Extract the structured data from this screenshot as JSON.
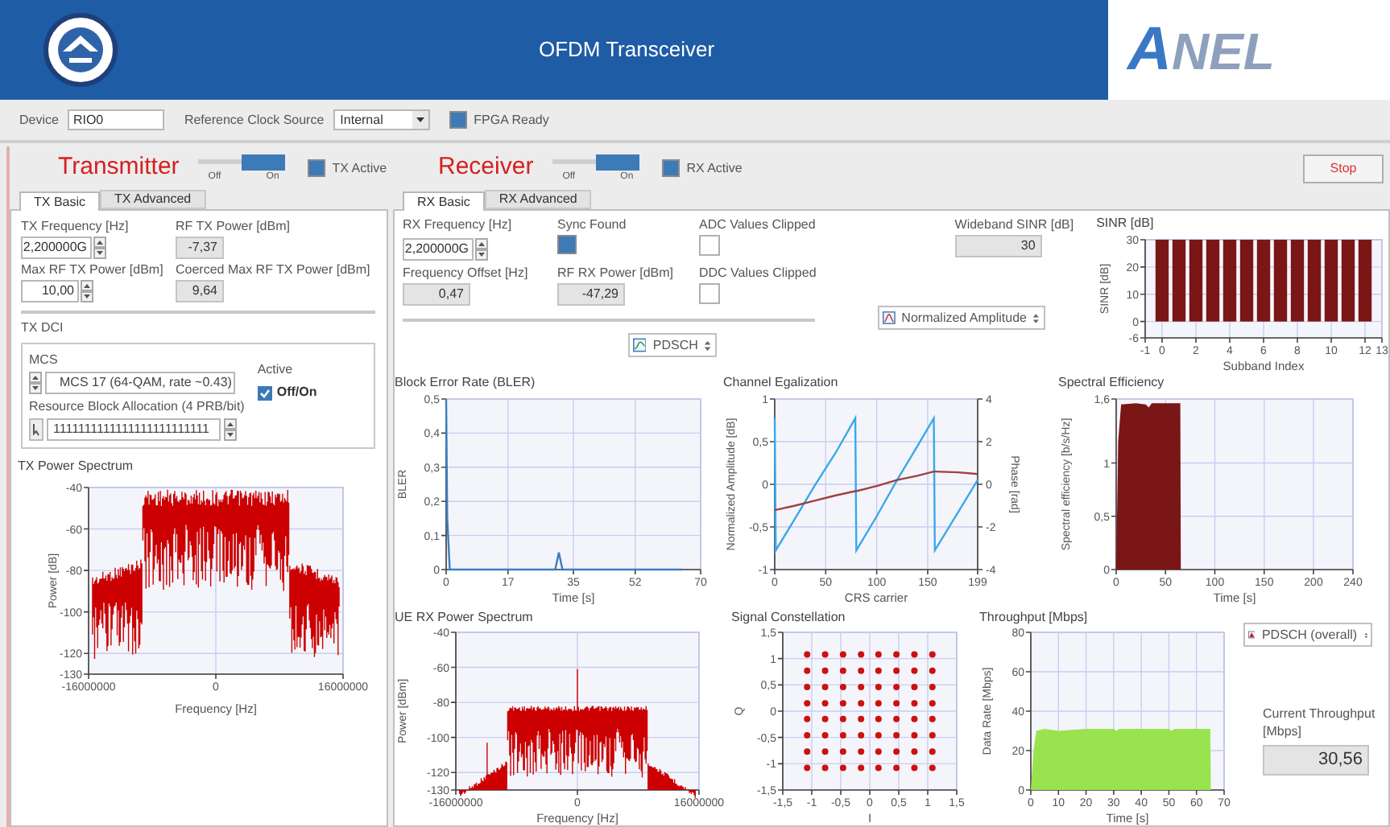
{
  "header": {
    "title": "OFDM Transceiver",
    "brand": "ANEL"
  },
  "toolbar": {
    "device_label": "Device",
    "device_value": "RIO0",
    "clock_label": "Reference Clock Source",
    "clock_value": "Internal",
    "fpga_label": "FPGA Ready",
    "fpga_ready": true
  },
  "transmitter": {
    "title": "Transmitter",
    "switch": {
      "off_label": "Off",
      "on_label": "On",
      "on": true
    },
    "active": {
      "label": "TX Active",
      "on": true
    },
    "tabs": [
      {
        "label": "TX Basic",
        "selected": true
      },
      {
        "label": "TX Advanced",
        "selected": false
      }
    ],
    "tx_frequency": {
      "label": "TX Frequency [Hz]",
      "value": "2,200000G"
    },
    "rf_tx_power": {
      "label": "RF TX Power [dBm]",
      "value": "-7,37"
    },
    "max_rf_tx_power": {
      "label": "Max RF TX Power [dBm]",
      "value": "10,00"
    },
    "coerced_max_power": {
      "label": "Coerced Max RF TX Power [dBm]",
      "value": "9,64"
    },
    "dci": {
      "title": "TX DCI",
      "mcs_label": "MCS",
      "mcs_value": "MCS 17 (64-QAM, rate ~0.43)",
      "active_label": "Active",
      "active_option": {
        "label": "Off/On",
        "checked": true
      },
      "rba_label": "Resource Block Allocation (4 PRB/bit)",
      "rba_value": "1111111111111111111111111"
    },
    "spectrum": {
      "title": "TX Power Spectrum",
      "xlabel": "Frequency [Hz]",
      "ylabel": "Power [dB]",
      "xticks": [
        "-16000000",
        "0",
        "16000000"
      ],
      "yticks": [
        "-40",
        "-60",
        "-80",
        "-100",
        "-120",
        "-130"
      ]
    }
  },
  "receiver": {
    "title": "Receiver",
    "switch": {
      "off_label": "Off",
      "on_label": "On",
      "on": true
    },
    "active": {
      "label": "RX Active",
      "on": true
    },
    "stop_button": "Stop",
    "tabs": [
      {
        "label": "RX Basic",
        "selected": true
      },
      {
        "label": "RX Advanced",
        "selected": false
      }
    ],
    "rx_frequency": {
      "label": "RX Frequency [Hz]",
      "value": "2,200000G"
    },
    "sync_found": {
      "label": "Sync Found",
      "on": true
    },
    "adc_clipped": {
      "label": "ADC Values Clipped",
      "on": false
    },
    "frequency_offset": {
      "label": "Frequency Offset [Hz]",
      "value": "0,47"
    },
    "rf_rx_power": {
      "label": "RF RX Power [dBm]",
      "value": "-47,29"
    },
    "ddc_clipped": {
      "label": "DDC Values Clipped",
      "on": false
    },
    "wideband_sinr": {
      "label": "Wideband SINR [dB]",
      "value": "30"
    },
    "channel_selector": {
      "value": "PDSCH"
    },
    "equalization_selector": {
      "value": "Normalized Amplitude"
    },
    "sinr": {
      "chart_data": {
        "type": "bar",
        "title": "SINR [dB]",
        "xlabel": "Subband Index",
        "ylabel": "SINR [dB]",
        "x": [
          0,
          1,
          2,
          3,
          4,
          5,
          6,
          7,
          8,
          9,
          10,
          11,
          12
        ],
        "series": [
          {
            "color": "#7a1616",
            "values": [
              30,
              30,
              30,
              30,
              30,
              30,
              30,
              30,
              30,
              30,
              30,
              30,
              30
            ]
          }
        ],
        "grid": true,
        "xlim": [
          -1,
          13
        ],
        "ylim": [
          -6,
          30
        ],
        "xticks": [
          -1,
          0,
          2,
          4,
          6,
          8,
          10,
          12,
          13
        ],
        "yticks": [
          -6,
          0,
          10,
          20,
          30
        ]
      }
    },
    "bler": {
      "chart_data": {
        "type": "line",
        "title": "Block Error Rate (BLER)",
        "xlabel": "Time [s]",
        "ylabel": "BLER",
        "x": [
          0,
          0.3,
          1,
          30,
          31,
          32,
          65
        ],
        "series": [
          {
            "color": "#3a7fc1",
            "values": [
              0.5,
              0.15,
              0,
              0,
              0.05,
              0,
              0
            ]
          }
        ],
        "grid": true,
        "xlim": [
          0,
          70
        ],
        "ylim": [
          0,
          0.5
        ],
        "xticks": [
          0,
          17,
          35,
          52,
          70
        ],
        "yticks": [
          {
            "value": 0,
            "label": "0"
          },
          {
            "value": 0.1,
            "label": "0,1"
          },
          {
            "value": 0.2,
            "label": "0,2"
          },
          {
            "value": 0.3,
            "label": "0,3"
          },
          {
            "value": 0.4,
            "label": "0,4"
          },
          {
            "value": 0.5,
            "label": "0,5"
          }
        ]
      }
    },
    "channel_equalization": {
      "chart_data": {
        "type": "line",
        "title": "Channel Egalization",
        "xlabel": "CRS carrier",
        "ylabel": "Normalized Amplitude [dB]",
        "y2label": "Phase [rad]",
        "grid": true,
        "x": [
          0,
          1,
          20,
          40,
          60,
          79,
          80,
          100,
          120,
          140,
          156,
          157,
          180,
          199
        ],
        "series": [
          {
            "color": "#3aa8ea",
            "axis": "y2",
            "values": [
              3.1,
              -3.1,
              -1.6,
              0,
              1.5,
              3.1,
              -3.1,
              -1.5,
              0.2,
              1.8,
              3.1,
              -3.1,
              -1.3,
              0.2
            ]
          },
          {
            "color": "#a04040",
            "values": [
              -0.3,
              -0.3,
              -0.25,
              -0.19,
              -0.13,
              -0.08,
              -0.08,
              -0.02,
              0.05,
              0.1,
              0.15,
              0.15,
              0.14,
              0.12
            ]
          }
        ],
        "xlim": [
          0,
          199
        ],
        "ylim": [
          -1,
          1
        ],
        "y2lim": [
          -4,
          4
        ],
        "xticks": [
          0,
          50,
          100,
          150,
          199
        ],
        "yticks": [
          {
            "value": 1,
            "label": "1"
          },
          {
            "value": 0.5,
            "label": "0,5"
          },
          {
            "value": 0,
            "label": "0"
          },
          {
            "value": -0.5,
            "label": "-0,5"
          },
          {
            "value": -1,
            "label": "-1"
          }
        ],
        "y2ticks": [
          4,
          2,
          0,
          -2,
          -4
        ]
      }
    },
    "spectral_efficiency": {
      "chart_data": {
        "type": "area",
        "title": "Spectral Efficiency",
        "xlabel": "Time [s]",
        "ylabel": "Spectral efficiency [b/s/Hz]",
        "x": [
          0,
          2,
          5,
          20,
          30,
          33,
          36,
          50,
          65,
          65.5
        ],
        "series": [
          {
            "color": "#7a1616",
            "values": [
              0,
              1.2,
              1.55,
              1.56,
              1.55,
              1.52,
              1.56,
              1.56,
              1.56,
              0
            ]
          }
        ],
        "grid": true,
        "xlim": [
          0,
          240
        ],
        "ylim": [
          0,
          1.6
        ],
        "xticks": [
          0,
          50,
          100,
          150,
          200,
          240
        ],
        "yticks": [
          {
            "value": 0,
            "label": "0"
          },
          {
            "value": 0.5,
            "label": "0,5"
          },
          {
            "value": 1,
            "label": "1"
          },
          {
            "value": 1.6,
            "label": "1,6"
          }
        ]
      }
    },
    "rx_spectrum": {
      "title": "UE RX Power Spectrum",
      "xlabel": "Frequency [Hz]",
      "ylabel": "Power [dBm]",
      "xticks": [
        "-16000000",
        "0",
        "16000000"
      ],
      "yticks": [
        "-40",
        "-60",
        "-80",
        "-100",
        "-120",
        "-130"
      ]
    },
    "constellation": {
      "chart_data": {
        "type": "scatter",
        "title": "Signal Constellation",
        "xlabel": "I",
        "ylabel": "Q",
        "x": [
          -1.08,
          -0.77,
          -0.46,
          -0.15,
          0.15,
          0.46,
          0.77,
          1.08,
          -1.08,
          -0.77,
          -0.46,
          -0.15,
          0.15,
          0.46,
          0.77,
          1.08,
          -1.08,
          -0.77,
          -0.46,
          -0.15,
          0.15,
          0.46,
          0.77,
          1.08,
          -1.08,
          -0.77,
          -0.46,
          -0.15,
          0.15,
          0.46,
          0.77,
          1.08,
          -1.08,
          -0.77,
          -0.46,
          -0.15,
          0.15,
          0.46,
          0.77,
          1.08,
          -1.08,
          -0.77,
          -0.46,
          -0.15,
          0.15,
          0.46,
          0.77,
          1.08,
          -1.08,
          -0.77,
          -0.46,
          -0.15,
          0.15,
          0.46,
          0.77,
          1.08,
          -1.08,
          -0.77,
          -0.46,
          -0.15,
          0.15,
          0.46,
          0.77,
          1.08
        ],
        "grid": true,
        "series": [
          {
            "color": "#cc1111",
            "values": [
              1.08,
              1.08,
              1.08,
              1.08,
              1.08,
              1.08,
              1.08,
              1.08,
              0.77,
              0.77,
              0.77,
              0.77,
              0.77,
              0.77,
              0.77,
              0.77,
              0.46,
              0.46,
              0.46,
              0.46,
              0.46,
              0.46,
              0.46,
              0.46,
              0.15,
              0.15,
              0.15,
              0.15,
              0.15,
              0.15,
              0.15,
              0.15,
              -0.15,
              -0.15,
              -0.15,
              -0.15,
              -0.15,
              -0.15,
              -0.15,
              -0.15,
              -0.46,
              -0.46,
              -0.46,
              -0.46,
              -0.46,
              -0.46,
              -0.46,
              -0.46,
              -0.77,
              -0.77,
              -0.77,
              -0.77,
              -0.77,
              -0.77,
              -0.77,
              -0.77,
              -1.08,
              -1.08,
              -1.08,
              -1.08,
              -1.08,
              -1.08,
              -1.08,
              -1.08
            ]
          }
        ],
        "xlim": [
          -1.5,
          1.5
        ],
        "ylim": [
          -1.5,
          1.5
        ],
        "xticks": [
          {
            "value": -1.5,
            "label": "-1,5"
          },
          {
            "value": -1,
            "label": "-1"
          },
          {
            "value": -0.5,
            "label": "-0,5"
          },
          {
            "value": 0,
            "label": "0"
          },
          {
            "value": 0.5,
            "label": "0,5"
          },
          {
            "value": 1,
            "label": "1"
          },
          {
            "value": 1.5,
            "label": "1,5"
          }
        ],
        "yticks": [
          {
            "value": -1.5,
            "label": "-1,5"
          },
          {
            "value": -1,
            "label": "-1"
          },
          {
            "value": -0.5,
            "label": "-0,5"
          },
          {
            "value": 0,
            "label": "0"
          },
          {
            "value": 0.5,
            "label": "0,5"
          },
          {
            "value": 1,
            "label": "1"
          },
          {
            "value": 1.5,
            "label": "1,5"
          }
        ]
      }
    },
    "throughput": {
      "chart_data": {
        "type": "area",
        "title": "Throughput [Mbps]",
        "xlabel": "Time [s]",
        "ylabel": "Data Rate [Mbps]",
        "x": [
          0,
          1,
          2,
          5,
          10,
          20,
          30,
          31,
          32,
          40,
          50,
          51,
          52,
          60,
          65,
          65.2
        ],
        "series": [
          {
            "color": "#99e34f",
            "values": [
              0,
              20,
              30,
              31,
              30,
              31,
              31,
              30,
              31,
              31,
              31,
              30,
              31,
              31,
              31,
              0
            ]
          }
        ],
        "grid": true,
        "xlim": [
          0,
          70
        ],
        "ylim": [
          0,
          80
        ],
        "xticks": [
          0,
          10,
          20,
          30,
          40,
          50,
          60,
          70
        ],
        "yticks": [
          0,
          20,
          40,
          60,
          80
        ]
      }
    },
    "throughput_selector": {
      "value": "PDSCH (overall)"
    },
    "current_throughput": {
      "label": "Current Throughput [Mbps]",
      "value": "30,56"
    }
  }
}
